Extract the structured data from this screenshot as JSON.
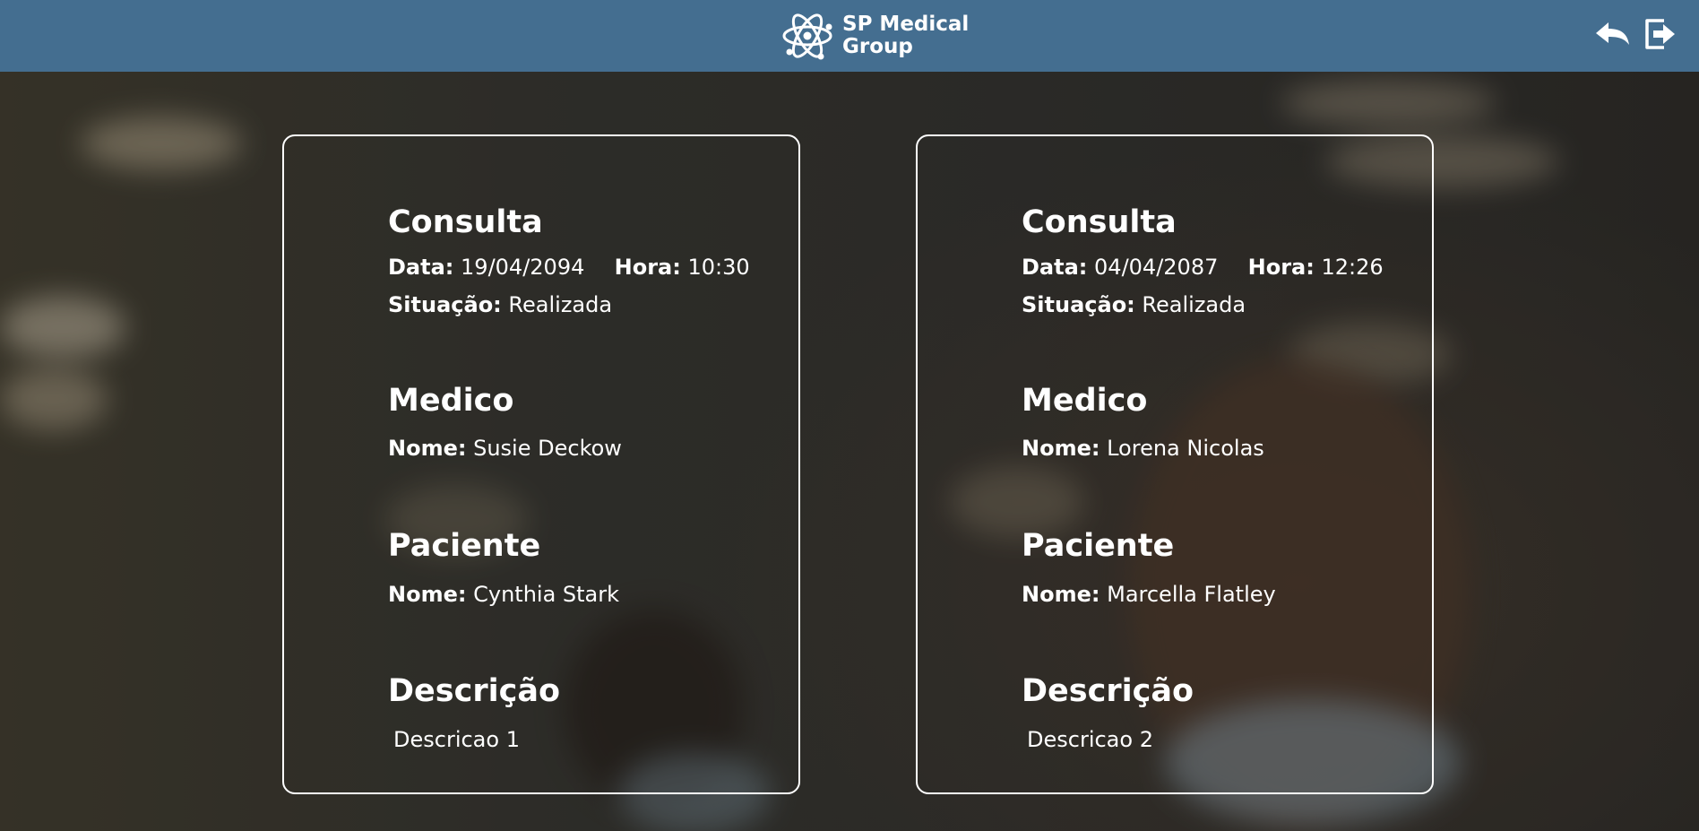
{
  "header": {
    "logo_line1": "SP Medical",
    "logo_line2": "Group",
    "icons": {
      "logo": "atom-icon",
      "back": "back-arrow-icon",
      "logout": "logout-icon"
    },
    "color": "#446e90"
  },
  "cards": [
    {
      "consulta_title": "Consulta",
      "data_label": "Data:",
      "data_value": "19/04/2094",
      "hora_label": "Hora:",
      "hora_value": "10:30",
      "situacao_label": "Situação:",
      "situacao_value": "Realizada",
      "medico_title": "Medico",
      "medico_nome_label": "Nome:",
      "medico_nome_value": "Susie Deckow",
      "paciente_title": "Paciente",
      "paciente_nome_label": "Nome:",
      "paciente_nome_value": "Cynthia Stark",
      "descricao_title": "Descrição",
      "descricao_value": "Descricao 1"
    },
    {
      "consulta_title": "Consulta",
      "data_label": "Data:",
      "data_value": "04/04/2087",
      "hora_label": "Hora:",
      "hora_value": "12:26",
      "situacao_label": "Situação:",
      "situacao_value": "Realizada",
      "medico_title": "Medico",
      "medico_nome_label": "Nome:",
      "medico_nome_value": "Lorena Nicolas",
      "paciente_title": "Paciente",
      "paciente_nome_label": "Nome:",
      "paciente_nome_value": "Marcella Flatley",
      "descricao_title": "Descrição",
      "descricao_value": "Descricao 2"
    }
  ]
}
